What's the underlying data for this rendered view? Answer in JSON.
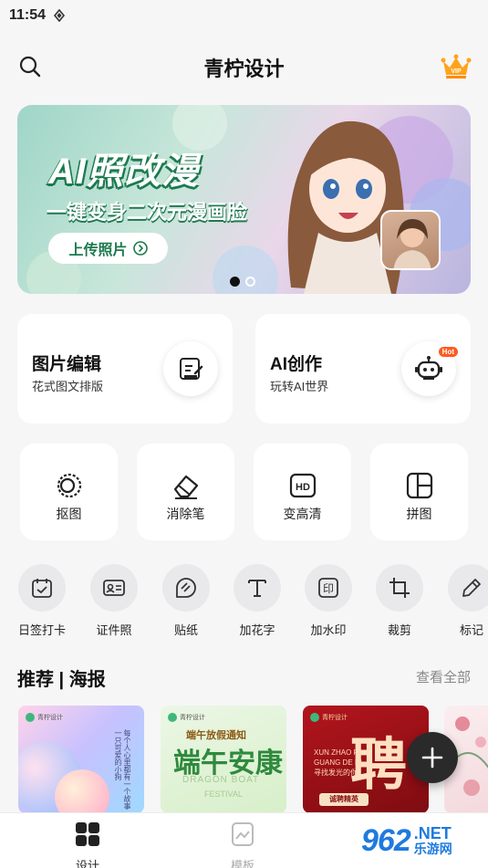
{
  "status_bar": {
    "time": "11:54"
  },
  "header": {
    "title": "青柠设计"
  },
  "banner": {
    "headline": "AI照改漫",
    "subtitle": "一键变身二次元漫画脸",
    "upload_label": "上传照片"
  },
  "feature_cards": [
    {
      "title": "图片编辑",
      "desc": "花式图文排版"
    },
    {
      "title": "AI创作",
      "desc": "玩转AI世界",
      "badge": "Hot"
    }
  ],
  "tools": [
    {
      "label": "抠图"
    },
    {
      "label": "消除笔"
    },
    {
      "label": "变高清"
    },
    {
      "label": "拼图"
    }
  ],
  "mini_tools": [
    {
      "label": "日签打卡"
    },
    {
      "label": "证件照"
    },
    {
      "label": "贴纸"
    },
    {
      "label": "加花字"
    },
    {
      "label": "加水印"
    },
    {
      "label": "裁剪"
    },
    {
      "label": "标记"
    }
  ],
  "section": {
    "title": "推荐 | 海报",
    "see_all": "查看全部"
  },
  "posters": [
    {
      "brand": "青柠设计",
      "vertical_text": "每个人心里都有一个故事 一只可爱的小狗"
    },
    {
      "brand": "青柠设计",
      "line1": "端午放假通知",
      "line2": "端午安康",
      "line3": "DRAGON BOAT",
      "line4": "FESTIVAL"
    },
    {
      "brand": "青柠设计",
      "big": "聘",
      "side": "XUN ZHAO FA GUANG DE NI 寻找发光的你",
      "button": "诚聘精英"
    }
  ],
  "tabbar": [
    {
      "label": "设计"
    },
    {
      "label": "模板"
    }
  ],
  "watermark": {
    "logo_num": "962",
    "net": ".NET",
    "cn": "乐游网"
  }
}
